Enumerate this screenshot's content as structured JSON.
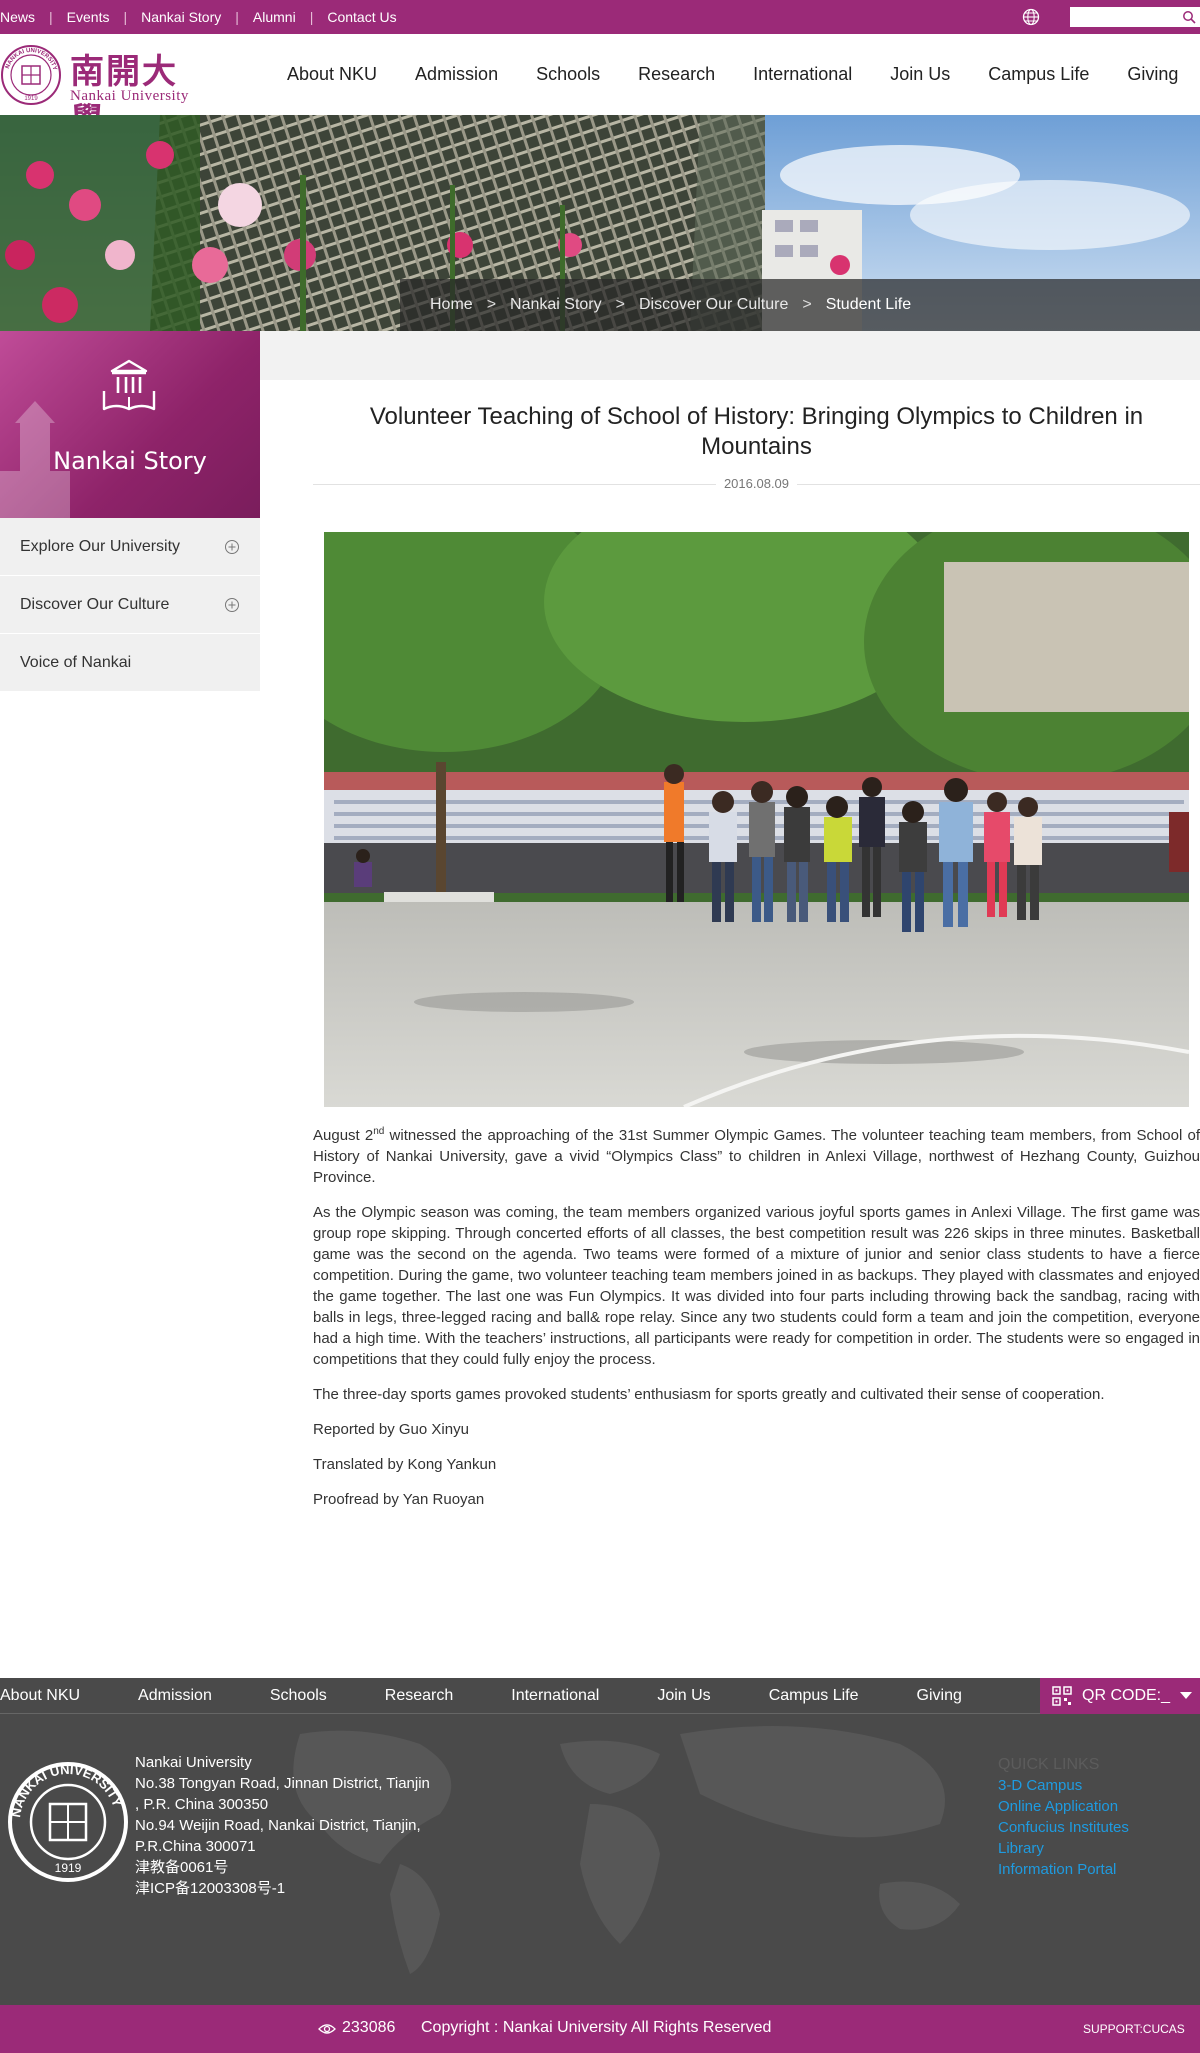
{
  "topbar": {
    "links": [
      "News",
      "Events",
      "Nankai Story",
      "Alumni",
      "Contact Us"
    ],
    "search_placeholder": ""
  },
  "header": {
    "logo_cn": "南開大學",
    "logo_en": "Nankai University",
    "seal_text": "NANKAI UNIVERSITY",
    "seal_year": "1919",
    "nav": [
      "About NKU",
      "Admission",
      "Schools",
      "Research",
      "International",
      "Join Us",
      "Campus Life",
      "Giving"
    ]
  },
  "breadcrumb": [
    "Home",
    "Nankai Story",
    "Discover Our Culture",
    "Student Life"
  ],
  "breadcrumb_sep": ">",
  "sidebar": {
    "title": "Nankai Story",
    "items": [
      {
        "label": "Explore Our University",
        "expandable": true
      },
      {
        "label": "Discover Our Culture",
        "expandable": true
      },
      {
        "label": "Voice of Nankai",
        "expandable": false
      }
    ]
  },
  "article": {
    "title": "Volunteer Teaching of School of History: Bringing Olympics to Children in Mountains",
    "date": "2016.08.09",
    "p1_a": "August 2",
    "p1_sup": "nd",
    "p1_b": " witnessed the approaching of the 31st Summer Olympic Games. The volunteer teaching team members, from School of History of Nankai University, gave a vivid “Olympics Class” to children in Anlexi Village, northwest of Hezhang County, Guizhou Province.",
    "p2": "As the Olympic season was coming, the team members organized various joyful sports games in Anlexi Village. The first game was group rope skipping. Through concerted efforts of all classes, the best competition result was 226 skips in three minutes. Basketball game was the second on the agenda. Two teams were formed of a mixture of junior and senior class students to have a fierce competition. During the game, two volunteer teaching team members joined in as backups. They played with classmates and enjoyed the game together. The last one was Fun Olympics. It was divided into four parts including throwing back the sandbag, racing with balls in legs, three-legged racing and ball& rope relay. Since any two students could form a team and join the competition, everyone had a high time. With the teachers’ instructions, all participants were ready for competition in order. The students were so engaged in competitions that they could fully enjoy the process.",
    "p3": "The three-day sports games provoked students’ enthusiasm for sports greatly and cultivated their sense of cooperation.",
    "p4": "Reported by Guo Xinyu",
    "p5": "Translated by Kong Yankun",
    "p6": "Proofread by Yan Ruoyan"
  },
  "footer": {
    "nav": [
      "About NKU",
      "Admission",
      "Schools",
      "Research",
      "International",
      "Join Us",
      "Campus Life",
      "Giving"
    ],
    "qr_label": "QR CODE:_",
    "address": [
      "Nankai University",
      "No.38 Tongyan Road, Jinnan District, Tianjin",
      ", P.R. China 300350",
      "No.94 Weijin Road,  Nankai District, Tianjin,",
      "P.R.China  300071",
      "津教备0061号",
      "津ICP备12003308号-1"
    ],
    "quick_links_heading": "QUICK LINKS",
    "quick_links": [
      "3-D Campus",
      "Online Application",
      "Confucius Institutes",
      "Library",
      "Information Portal"
    ],
    "visit_count": "233086",
    "copyright": "Copyright : Nankai University All Rights Reserved",
    "support": "SUPPORT:CUCAS"
  },
  "colors": {
    "brand": "#9b2a78",
    "footer_bg": "#4a4a4a",
    "link_blue": "#1e9be0"
  },
  "icons": [
    "globe-icon",
    "search-icon",
    "book-building-icon",
    "plus-circle-icon",
    "qr-code-icon",
    "caret-down-icon",
    "eye-icon",
    "university-seal-icon"
  ]
}
